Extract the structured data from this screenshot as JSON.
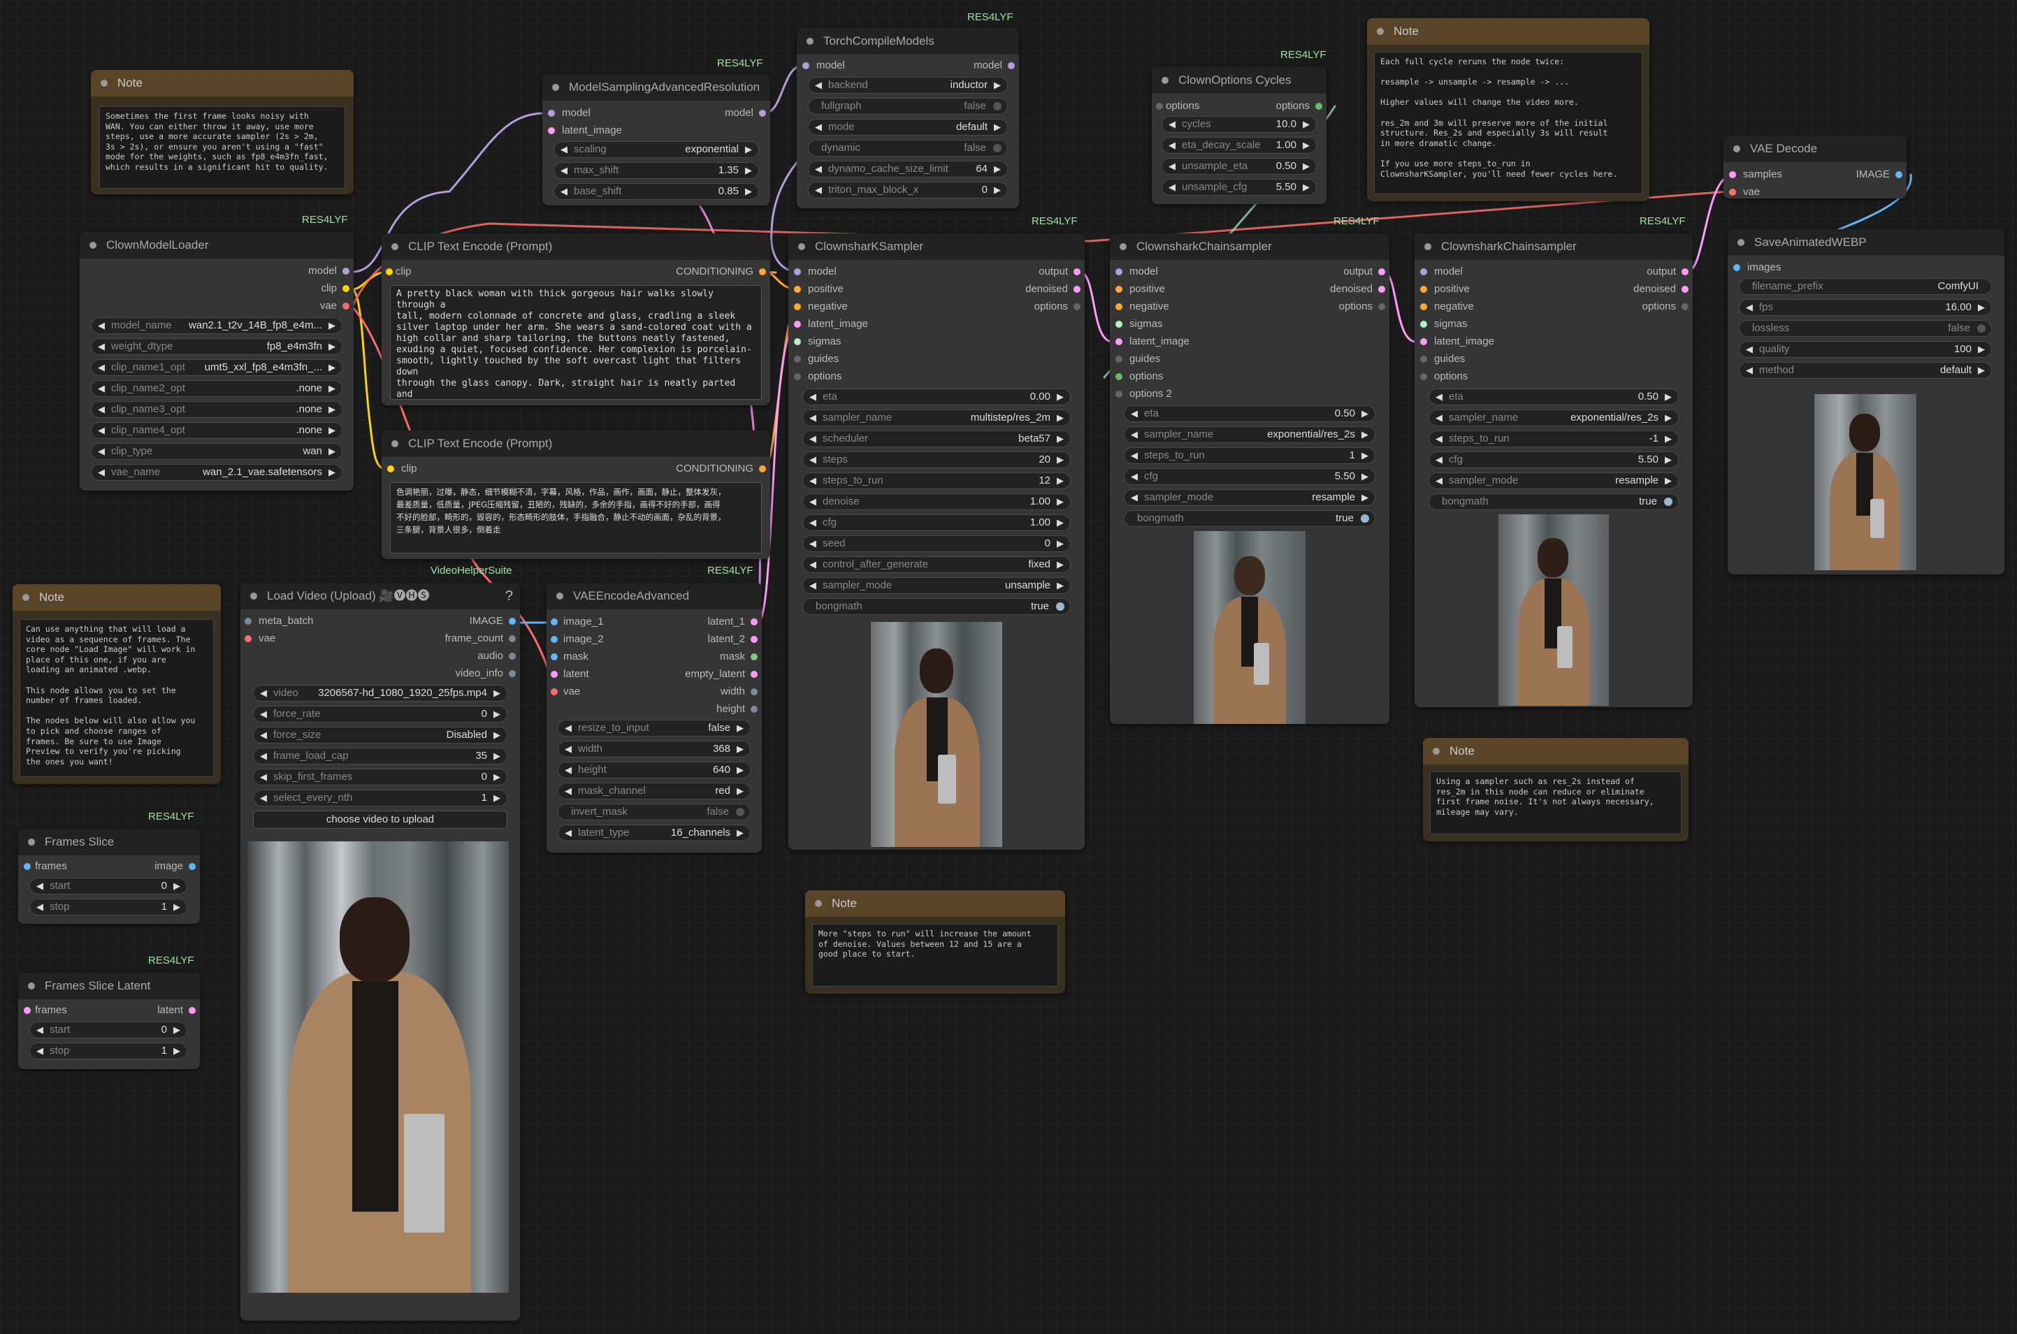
{
  "colors": {
    "canvas": "#1b1b1b",
    "node_body": "#353535",
    "node_header": "#222222",
    "note_header": "#5a4428",
    "note_body": "#3a3020",
    "badge": "#9fe0a8",
    "link_model": "#b39ddb",
    "link_clip": "#ffd500",
    "link_vae": "#ff6e6e",
    "link_conditioning": "#ffa931",
    "link_latent": "#ff9cf9",
    "link_image": "#64b5f6",
    "link_sigmas": "#b6f0c0"
  },
  "badges": {
    "b_msar": "RES4LYF",
    "b_tcm": "RES4LYF",
    "b_coc": "RES4LYF",
    "b_cml": "RES4LYF",
    "b_ks": "RES4LYF",
    "b_cs1": "RES4LYF",
    "b_cs2": "RES4LYF",
    "b_vhs": "VideoHelperSuite",
    "b_vea": "RES4LYF",
    "b_fs": "RES4LYF",
    "b_fsl": "RES4LYF"
  },
  "note1": {
    "title": "Note",
    "text": "Sometimes the first frame looks noisy with\nWAN. You can either throw it away, use more\nsteps, use a more accurate sampler (2s > 2m,\n3s > 2s), or ensure you aren't using a \"fast\"\nmode for the weights, such as fp8_e4m3fn_fast,\nwhich results in a significant hit to quality."
  },
  "note2": {
    "title": "Note",
    "text": "Can use anything that will load a\nvideo as a sequence of frames. The\ncore node \"Load Image\" will work in\nplace of this one, if you are\nloading an animated .webp.\n\nThis node allows you to set the\nnumber of frames loaded.\n\nThe nodes below will also allow you\nto pick and choose ranges of\nframes. Be sure to use Image\nPreview to verify you're picking\nthe ones you want!"
  },
  "note3": {
    "title": "Note",
    "text": "Each full cycle reruns the node twice:\n\nresample -> unsample -> resample -> ...\n\nHigher values will change the video more.\n\nres_2m and 3m will preserve more of the initial\nstructure. Res_2s and especially 3s will result\nin more dramatic change.\n\nIf you use more steps_to_run in\nClownsharKSampler, you'll need fewer cycles here."
  },
  "note4": {
    "title": "Note",
    "text": "Using a sampler such as res_2s instead of\nres_2m in this node can reduce or eliminate\nfirst frame noise. It's not always necessary,\nmileage may vary."
  },
  "note5": {
    "title": "Note",
    "text": "More \"steps to run\" will increase the amount\nof denoise. Values between 12 and 15 are a\ngood place to start."
  },
  "cml": {
    "title": "ClownModelLoader",
    "outputs": [
      "model",
      "clip",
      "vae"
    ],
    "widgets": [
      [
        "model_name",
        "wan2.1_t2v_14B_fp8_e4m..."
      ],
      [
        "weight_dtype",
        "fp8_e4m3fn"
      ],
      [
        "clip_name1_opt",
        "umt5_xxl_fp8_e4m3fn_..."
      ],
      [
        "clip_name2_opt",
        ".none"
      ],
      [
        "clip_name3_opt",
        ".none"
      ],
      [
        "clip_name4_opt",
        ".none"
      ],
      [
        "clip_type",
        "wan"
      ],
      [
        "vae_name",
        "wan_2.1_vae.safetensors"
      ]
    ]
  },
  "msar": {
    "title": "ModelSamplingAdvancedResolution",
    "inputs": [
      "model",
      "latent_image"
    ],
    "output": "model",
    "widgets": [
      [
        "scaling",
        "exponential"
      ],
      [
        "max_shift",
        "1.35"
      ],
      [
        "base_shift",
        "0.85"
      ]
    ]
  },
  "tcm": {
    "title": "TorchCompileModels",
    "input": "model",
    "output": "model",
    "widgets": [
      [
        "backend",
        "inductor"
      ],
      [
        "fullgraph",
        "false"
      ],
      [
        "mode",
        "default"
      ],
      [
        "dynamic",
        "false"
      ],
      [
        "dynamo_cache_size_limit",
        "64"
      ],
      [
        "triton_max_block_x",
        "0"
      ]
    ]
  },
  "coc": {
    "title": "ClownOptions Cycles",
    "input": "options",
    "output": "options",
    "widgets": [
      [
        "cycles",
        "10.0"
      ],
      [
        "eta_decay_scale",
        "1.00"
      ],
      [
        "unsample_eta",
        "0.50"
      ],
      [
        "unsample_cfg",
        "5.50"
      ]
    ]
  },
  "vaed": {
    "title": "VAE Decode",
    "inputs": [
      "samples",
      "vae"
    ],
    "output": "IMAGE"
  },
  "cte1": {
    "title": "CLIP Text Encode (Prompt)",
    "input": "clip",
    "output": "CONDITIONING",
    "text": "A pretty black woman with thick gorgeous hair walks slowly through a\ntall, modern colonnade of concrete and glass, cradling a sleek\nsilver laptop under her arm. She wears a sand-colored coat with a\nhigh collar and sharp tailoring, the buttons neatly fastened,\nexuding a quiet, focused confidence. Her complexion is porcelain-\nsmooth, lightly touched by the soft overcast light that filters down\nthrough the glass canopy. Dark, straight hair is neatly parted and\ntucked behind one ear, moving ever so slightly as she walks. Her\nexpression is thoughtful, eyes cast downward in introspection, lips\ngently pressed into a faint, unreadable line."
  },
  "cte2": {
    "title": "CLIP Text Encode (Prompt)",
    "input": "clip",
    "output": "CONDITIONING",
    "text": "色调艳丽，过曝，静态，细节模糊不清，字幕，风格，作品，画作，画面，静止，整体发灰，\n最差质量，低质量，JPEG压缩残留，丑陋的，残缺的，多余的手指，画得不好的手部，画得\n不好的脸部，畸形的，毁容的，形态畸形的肢体，手指融合，静止不动的画面，杂乱的背景，\n三条腿，背景人很多，倒着走"
  },
  "ks": {
    "title": "ClownsharKSampler",
    "inputs": [
      "model",
      "positive",
      "negative",
      "latent_image",
      "sigmas",
      "guides",
      "options"
    ],
    "outputs": [
      "output",
      "denoised",
      "options"
    ],
    "widgets": [
      [
        "eta",
        "0.00"
      ],
      [
        "sampler_name",
        "multistep/res_2m"
      ],
      [
        "scheduler",
        "beta57"
      ],
      [
        "steps",
        "20"
      ],
      [
        "steps_to_run",
        "12"
      ],
      [
        "denoise",
        "1.00"
      ],
      [
        "cfg",
        "1.00"
      ],
      [
        "seed",
        "0"
      ],
      [
        "control_after_generate",
        "fixed"
      ],
      [
        "sampler_mode",
        "unsample"
      ]
    ],
    "toggle": [
      "bongmath",
      "true"
    ]
  },
  "cs1": {
    "title": "ClownsharkChainsampler",
    "inputs": [
      "model",
      "positive",
      "negative",
      "sigmas",
      "latent_image",
      "guides",
      "options",
      "options 2"
    ],
    "outputs": [
      "output",
      "denoised",
      "options"
    ],
    "widgets": [
      [
        "eta",
        "0.50"
      ],
      [
        "sampler_name",
        "exponential/res_2s"
      ],
      [
        "steps_to_run",
        "1"
      ],
      [
        "cfg",
        "5.50"
      ],
      [
        "sampler_mode",
        "resample"
      ]
    ],
    "toggle": [
      "bongmath",
      "true"
    ]
  },
  "cs2": {
    "title": "ClownsharkChainsampler",
    "inputs": [
      "model",
      "positive",
      "negative",
      "sigmas",
      "latent_image",
      "guides",
      "options"
    ],
    "outputs": [
      "output",
      "denoised",
      "options"
    ],
    "widgets": [
      [
        "eta",
        "0.50"
      ],
      [
        "sampler_name",
        "exponential/res_2s"
      ],
      [
        "steps_to_run",
        "-1"
      ],
      [
        "cfg",
        "5.50"
      ],
      [
        "sampler_mode",
        "resample"
      ]
    ],
    "toggle": [
      "bongmath",
      "true"
    ]
  },
  "saw": {
    "title": "SaveAnimatedWEBP",
    "input": "images",
    "widgets": [
      [
        "filename_prefix",
        "ComfyUI"
      ],
      [
        "fps",
        "16.00"
      ],
      [
        "quality",
        "100"
      ],
      [
        "method",
        "default"
      ]
    ],
    "toggle": [
      "lossless",
      "false"
    ]
  },
  "lv": {
    "title": "Load Video (Upload) 🎥🅥🅗🅢",
    "help": "?",
    "inputs": [
      "meta_batch",
      "vae"
    ],
    "outputs": [
      "IMAGE",
      "frame_count",
      "audio",
      "video_info"
    ],
    "widgets": [
      [
        "video",
        "3206567-hd_1080_1920_25fps.mp4"
      ],
      [
        "force_rate",
        "0"
      ],
      [
        "force_size",
        "Disabled"
      ],
      [
        "frame_load_cap",
        "35"
      ],
      [
        "skip_first_frames",
        "0"
      ],
      [
        "select_every_nth",
        "1"
      ]
    ],
    "button": "choose video to upload"
  },
  "vea": {
    "title": "VAEEncodeAdvanced",
    "inputs": [
      "image_1",
      "image_2",
      "mask",
      "latent",
      "vae"
    ],
    "outputs": [
      "latent_1",
      "latent_2",
      "mask",
      "empty_latent",
      "width",
      "height"
    ],
    "widgets": [
      [
        "resize_to_input",
        "false"
      ],
      [
        "width",
        "368"
      ],
      [
        "height",
        "640"
      ],
      [
        "mask_channel",
        "red"
      ],
      [
        "latent_type",
        "16_channels"
      ]
    ],
    "toggle": [
      "invert_mask",
      "false"
    ]
  },
  "fs": {
    "title": "Frames Slice",
    "input": "frames",
    "output": "image",
    "widgets": [
      [
        "start",
        "0"
      ],
      [
        "stop",
        "1"
      ]
    ]
  },
  "fsl": {
    "title": "Frames Slice Latent",
    "input": "frames",
    "output": "latent",
    "widgets": [
      [
        "start",
        "0"
      ],
      [
        "stop",
        "1"
      ]
    ]
  }
}
